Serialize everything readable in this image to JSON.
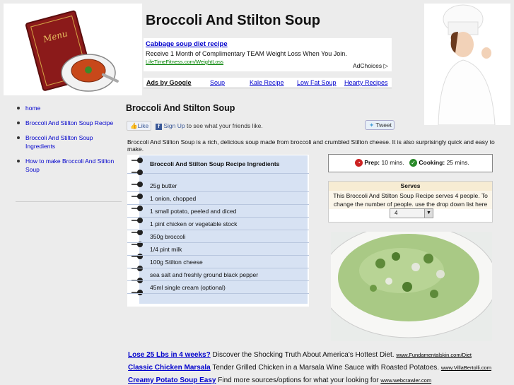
{
  "site": {
    "title": "Broccoli And Stilton Soup"
  },
  "ad_top": {
    "title": "Cabbage soup diet recipe",
    "text": "Receive 1 Month of Complimentary TEAM Weight Loss When You Join.",
    "url": "LifeTimeFitness.com/WeightLoss",
    "adchoices": "AdChoices"
  },
  "ad_links": {
    "label": "Ads by Google",
    "items": [
      "Soup",
      "Kale Recipe",
      "Low Fat Soup",
      "Hearty Recipes"
    ]
  },
  "sidebar": {
    "items": [
      "home",
      "Broccoli And Stilton Soup Recipe",
      "Broccoli And Stilton Soup Ingredients",
      "How to make Broccoli And Stilton Soup"
    ]
  },
  "main": {
    "heading": "Broccoli And Stilton Soup",
    "like_label": "Like",
    "signup_link": "Sign Up",
    "signup_text": " to see what your friends like.",
    "tweet_label": "Tweet",
    "intro": "Broccoli And Stilton Soup is a rich, delicious soup made from broccoli and crumbled Stilton cheese. It is also surprisingly quick and easy to make."
  },
  "ingredients": {
    "title": "Broccoli And Stilton Soup Recipe Ingredients",
    "items": [
      "25g butter",
      "1 onion, chopped",
      "1 small potato, peeled and diced",
      "1 pint chicken or vegetable stock",
      "350g broccoli",
      "1/4 pint milk",
      "100g Stilton cheese",
      "sea salt and freshly ground black pepper",
      "45ml single cream (optional)"
    ]
  },
  "prep": {
    "prep_label": "Prep:",
    "prep_value": "10 mins.",
    "cook_label": "Cooking:",
    "cook_value": "25 mins.",
    "prep_color": "#cc2222",
    "cook_color": "#2a8a2a"
  },
  "serves": {
    "heading": "Serves",
    "text": "This Broccoli And Stilton Soup Recipe serves 4 people. To change the number of people. use the drop down list here",
    "selected": "4"
  },
  "bottom_ads": [
    {
      "title": "Lose 25 Lbs in 4 weeks?",
      "text": " Discover the Shocking Truth About America's Hottest Diet. ",
      "url": "www.Fundamentalskin.com/Diet"
    },
    {
      "title": "Classic Chicken Marsala",
      "text": " Tender Grilled Chicken in a Marsala Wine Sauce with Roasted Potatoes. ",
      "url": "www.VillaBertolli.com"
    },
    {
      "title": "Creamy Potato Soup Easy",
      "text": " Find more sources/options for what your looking for ",
      "url": "www.webcrawler.com"
    }
  ]
}
